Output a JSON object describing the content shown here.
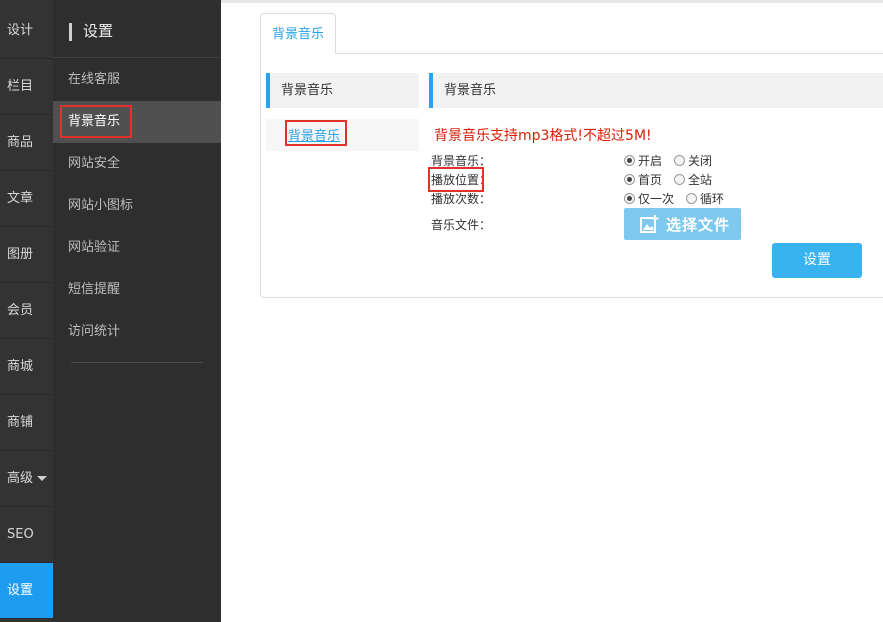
{
  "rail": {
    "items": [
      "设计",
      "栏目",
      "商品",
      "文章",
      "图册",
      "会员",
      "商城",
      "商铺",
      "高级",
      "SEO",
      "设置"
    ],
    "active_index": 10
  },
  "submenu": {
    "title": "设置",
    "items": [
      "在线客服",
      "背景音乐",
      "网站安全",
      "网站小图标",
      "网站验证",
      "短信提醒",
      "访问统计"
    ],
    "active_index": 1
  },
  "tab": {
    "label": "背景音乐"
  },
  "side": {
    "heading": "背景音乐",
    "link": "背景音乐"
  },
  "main": {
    "heading": "背景音乐",
    "notice": "背景音乐支持mp3格式!不超过5M!",
    "fields": [
      {
        "label": "背景音乐：",
        "options": [
          "开启",
          "关闭"
        ],
        "selected": 0
      },
      {
        "label": "播放位置：",
        "options": [
          "首页",
          "全站"
        ],
        "selected": 0
      },
      {
        "label": "播放次数：",
        "options": [
          "仅一次",
          "循环"
        ],
        "selected": 0
      },
      {
        "label": "音乐文件："
      }
    ],
    "file_button": "选择文件",
    "submit_button": "设置"
  },
  "colors": {
    "accent": "#2aa3e8",
    "highlight_box": "#e0312b",
    "notice": "#d81e06",
    "rail_bg": "#333333",
    "submenu_bg": "#2e2e2e"
  }
}
